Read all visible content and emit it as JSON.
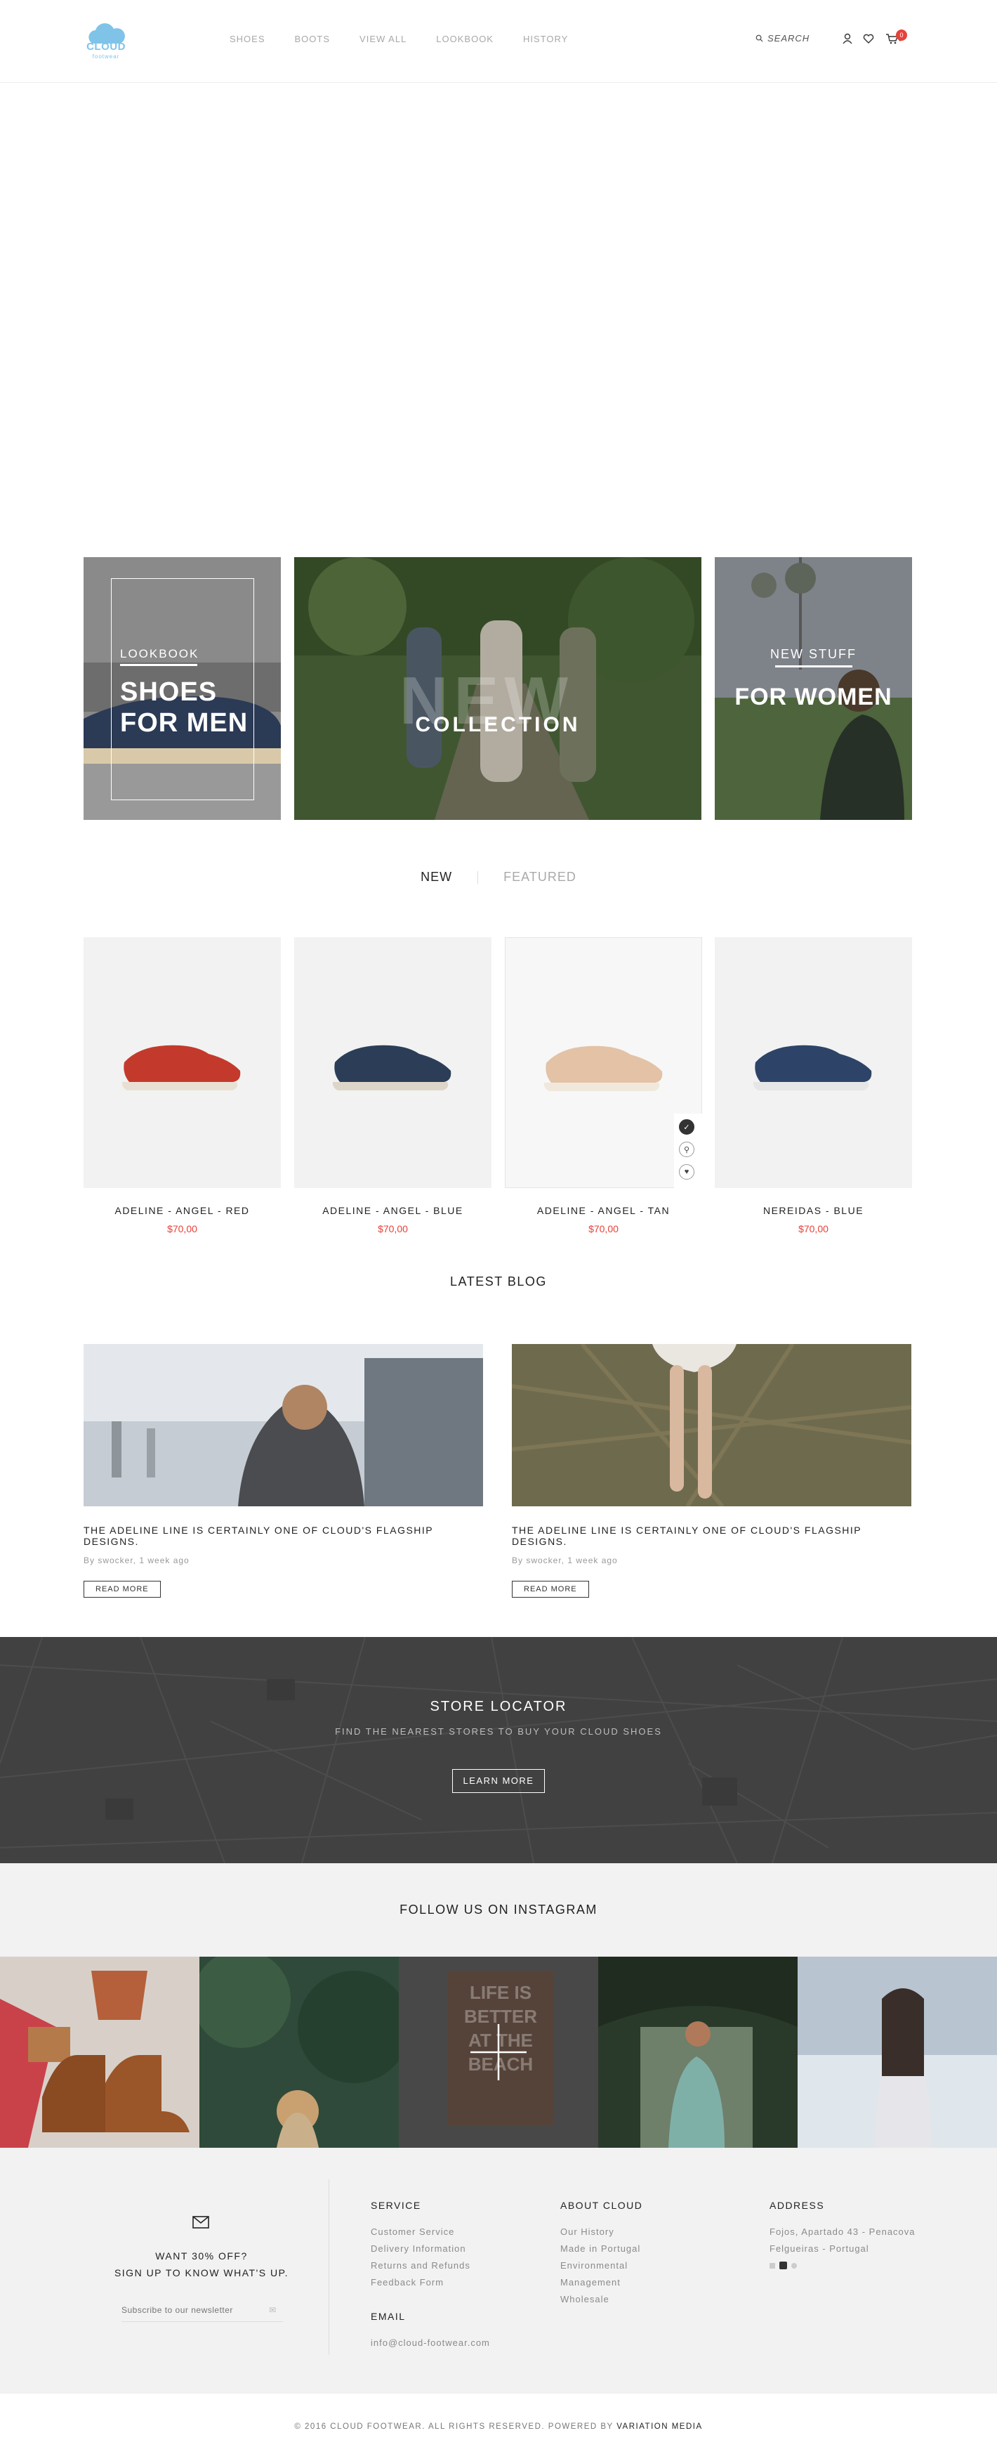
{
  "brand": {
    "logo_text": "CLOUD",
    "logo_sub": "footwear",
    "accent": "#e8413a",
    "logo_color": "#7fc4e8"
  },
  "nav": {
    "items": [
      "SHOES",
      "BOOTS",
      "VIEW ALL",
      "LOOKBOOK",
      "HISTORY"
    ]
  },
  "header": {
    "search_label": "SEARCH",
    "cart_count": "0"
  },
  "banners": {
    "men": {
      "kicker": "LOOKBOOK",
      "line1": "SHOES",
      "line2": "FOR MEN"
    },
    "collection": {
      "watermark": "NEW",
      "title": "COLLECTION"
    },
    "women": {
      "kicker": "NEW STUFF",
      "title": "FOR WOMEN"
    }
  },
  "tabs": {
    "new": "NEW",
    "featured": "FEATURED"
  },
  "products": [
    {
      "name": "ADELINE - ANGEL - RED",
      "price": "$70,00",
      "color": "#c33a2c"
    },
    {
      "name": "ADELINE - ANGEL - BLUE",
      "price": "$70,00",
      "color": "#2c3e57"
    },
    {
      "name": "ADELINE - ANGEL - TAN",
      "price": "$70,00",
      "color": "#e3c2a6"
    },
    {
      "name": "NEREIDAS - BLUE",
      "price": "$70,00",
      "color": "#2d4468"
    }
  ],
  "blog": {
    "title": "LATEST BLOG",
    "posts": [
      {
        "title": "THE ADELINE LINE IS CERTAINLY ONE OF CLOUD'S  FLAGSHIP DESIGNS.",
        "meta": "By swocker, 1 week ago",
        "button": "READ MORE"
      },
      {
        "title": "THE ADELINE LINE IS CERTAINLY ONE OF CLOUD'S  FLAGSHIP DESIGNS.",
        "meta": "By swocker, 1 week ago",
        "button": "READ MORE"
      }
    ]
  },
  "locator": {
    "title": "STORE LOCATOR",
    "subtitle": "FIND THE NEAREST STORES TO BUY YOUR CLOUD SHOES",
    "button": "LEARN MORE"
  },
  "instagram": {
    "title": "FOLLOW US ON INSTAGRAM",
    "overlay_text": [
      "LIFE IS",
      "BETTER",
      "AT THE",
      "BEACH"
    ]
  },
  "footer": {
    "promo_line1": "WANT 30% OFF?",
    "promo_line2": "SIGN UP TO KNOW WHAT'S UP.",
    "newsletter_placeholder": "Subscribe to our newsletter",
    "service": {
      "title": "SERVICE",
      "links": [
        "Customer Service",
        "Delivery Information",
        "Returns and Refunds",
        "Feedback Form"
      ]
    },
    "email": {
      "title": "EMAIL",
      "value": "info@cloud-footwear.com"
    },
    "about": {
      "title": "ABOUT CLOUD",
      "links": [
        "Our History",
        "Made in Portugal",
        "Environmental",
        "Management",
        "Wholesale"
      ]
    },
    "address": {
      "title": "ADDRESS",
      "line1": "Fojos, Apartado 43 - Penacova",
      "line2": "Felgueiras - Portugal"
    },
    "copyright_prefix": "© 2016 CLOUD FOOTWEAR. ALL RIGHTS RESERVED. POWERED BY",
    "copyright_link": "VARIATION MEDIA"
  }
}
